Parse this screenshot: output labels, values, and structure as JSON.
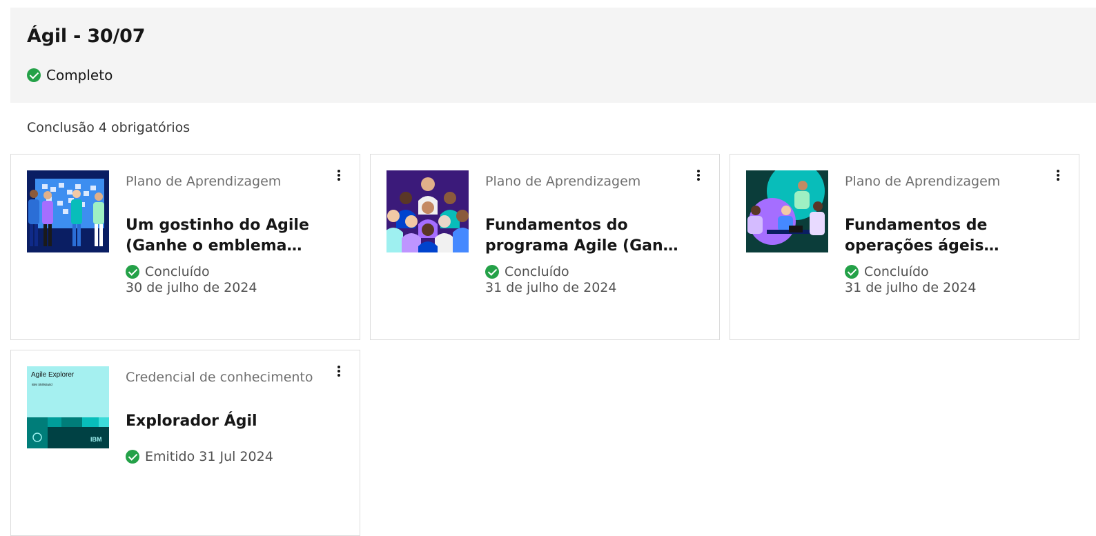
{
  "header": {
    "title": "Ágil - 30/07",
    "status": "Completo"
  },
  "requirement_text": "Conclusão 4 obrigatórios",
  "cards": [
    {
      "type": "Plano de Aprendizagem",
      "title": "Um gostinho do Agile (Ganhe o emblema Agile Explorer)",
      "status": "Concluído",
      "date": "30 de julho de 2024"
    },
    {
      "type": "Plano de Aprendizagem",
      "title": "Fundamentos do programa Agile (Ganhe o emblema)",
      "status": "Concluído",
      "date": "31 de julho de 2024"
    },
    {
      "type": "Plano de Aprendizagem",
      "title": "Fundamentos de operações ágeis (Ganhe o emblema)",
      "status": "Concluído",
      "date": "31 de julho de 2024"
    },
    {
      "type": "Credencial de conhecimento",
      "title": "Explorador Ágil",
      "status": "Emitido 31 Jul 2024",
      "badge": {
        "name": "Agile Explorer",
        "issuer": "IBM SkillsBuild",
        "brand": "IBM"
      }
    }
  ],
  "colors": {
    "success": "#24a148",
    "header_bg": "#f4f4f4",
    "border": "#dcdcdc"
  }
}
